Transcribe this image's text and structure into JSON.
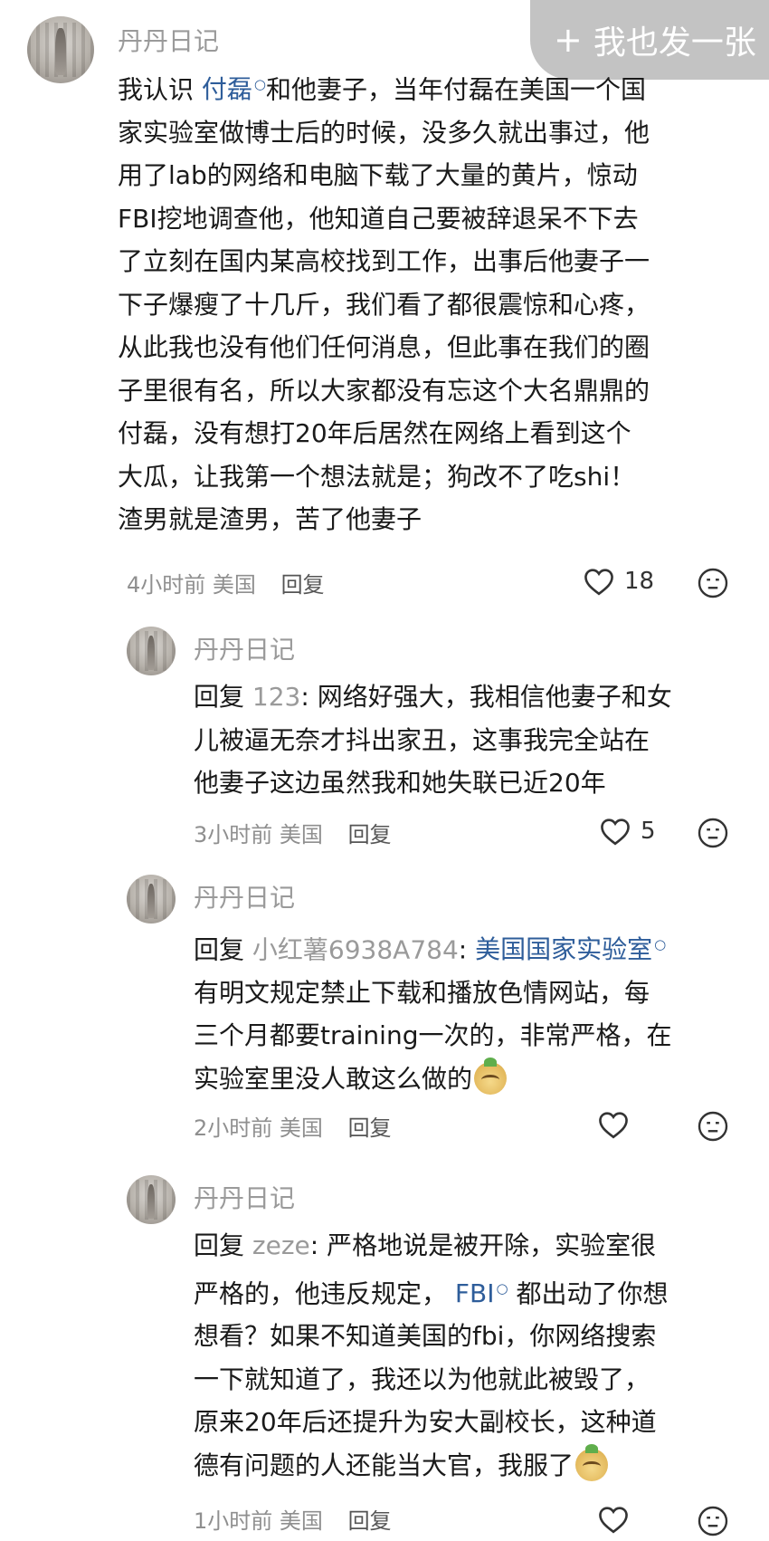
{
  "post_button": {
    "label": "我也发一张",
    "icon": "plus-icon"
  },
  "comments": [
    {
      "username": "丹丹日记",
      "lines": [
        [
          "我认识 ",
          "付磊",
          "和他妻子，当年付磊在美国一个国"
        ],
        "家实验室做博士后的时候，没多久就出事过，他",
        "用了lab的网络和电脑下载了大量的黄片，惊动",
        "FBI挖地调查他，他知道自己要被辞退呆不下去",
        "了立刻在国内某高校找到工作，出事后他妻子一",
        "下子爆瘦了十几斤，我们看了都很震惊和心疼，",
        "从此我也没有他们任何消息，但此事在我们的圈",
        "子里很有名，所以大家都没有忘这个大名鼎鼎的",
        "付磊，没有想打20年后居然在网络上看到这个",
        "大瓜，让我第一个想法就是；狗改不了吃shi！",
        "渣男就是渣男，苦了他妻子"
      ],
      "time": "4小时前",
      "location": "美国",
      "reply_label": "回复",
      "likes": "18"
    },
    {
      "username": "丹丹日记",
      "reply_prefix": "回复 ",
      "reply_to": "123",
      "first_line_rest": ": 网络好强大，我相信他妻子和女",
      "lines": [
        "儿被逼无奈才抖出家丑，这事我完全站在",
        "他妻子这边虽然我和她失联已近20年"
      ],
      "time": "3小时前",
      "location": "美国",
      "reply_label": "回复",
      "likes": "5"
    },
    {
      "username": "丹丹日记",
      "reply_prefix": "回复 ",
      "reply_to": "小红薯6938A784",
      "first_line_colon": ": ",
      "first_line_link": "美国国家实验室",
      "lines": [
        "有明文规定禁止下载和播放色情网站，每",
        "三个月都要training一次的，非常严格，在",
        "实验室里没人敢这么做的"
      ],
      "time": "2小时前",
      "location": "美国",
      "reply_label": "回复",
      "likes": ""
    },
    {
      "username": "丹丹日记",
      "reply_prefix": "回复 ",
      "reply_to": "zeze",
      "first_line_rest": ": 严格地说是被开除，实验室很",
      "second_line_pre": "严格的，他违反规定，",
      "second_line_link": "FBI",
      "second_line_post": "都出动了你想",
      "lines": [
        "想看？如果不知道美国的fbi，你网络搜索",
        "一下就知道了，我还以为他就此被毁了，",
        "原来20年后还提升为安大副校长，这种道",
        "德有问题的人还能当大官，我服了"
      ],
      "time": "1小时前",
      "location": "美国",
      "reply_label": "回复",
      "likes": ""
    }
  ],
  "icons": {
    "heart": "heart-outline-icon",
    "dislike": "unhappy-face-icon",
    "search_hint": "search-small-icon",
    "emoji": "sticker-emoji-icon"
  }
}
